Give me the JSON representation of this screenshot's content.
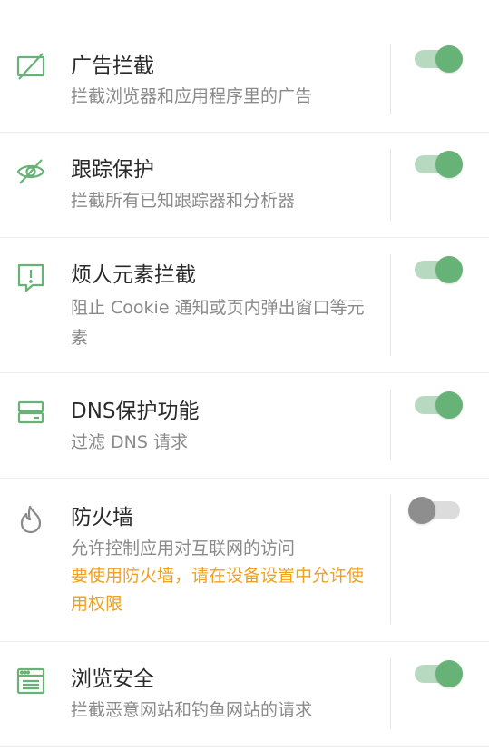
{
  "colors": {
    "accent": "#67b277",
    "warning": "#f0a020",
    "toggle_off": "#8e8e8e"
  },
  "items": [
    {
      "title": "广告拦截",
      "desc": "拦截浏览器和应用程序里的广告",
      "icon": "ad-block-icon",
      "enabled": true
    },
    {
      "title": "跟踪保护",
      "desc": "拦截所有已知跟踪器和分析器",
      "icon": "eye-slash-icon",
      "enabled": true
    },
    {
      "title": "烦人元素拦截",
      "desc": "阻止 Cookie 通知或页内弹出窗口等元素",
      "icon": "alert-bubble-icon",
      "enabled": true
    },
    {
      "title": "DNS保护功能",
      "desc": "过滤 DNS 请求",
      "icon": "server-icon",
      "enabled": true
    },
    {
      "title": "防火墙",
      "desc": "允许控制应用对互联网的访问",
      "warning": "要使用防火墙，请在设备设置中允许使用权限",
      "icon": "flame-icon",
      "enabled": false
    },
    {
      "title": "浏览安全",
      "desc": "拦截恶意网站和钓鱼网站的请求",
      "icon": "browser-window-icon",
      "enabled": true
    }
  ]
}
